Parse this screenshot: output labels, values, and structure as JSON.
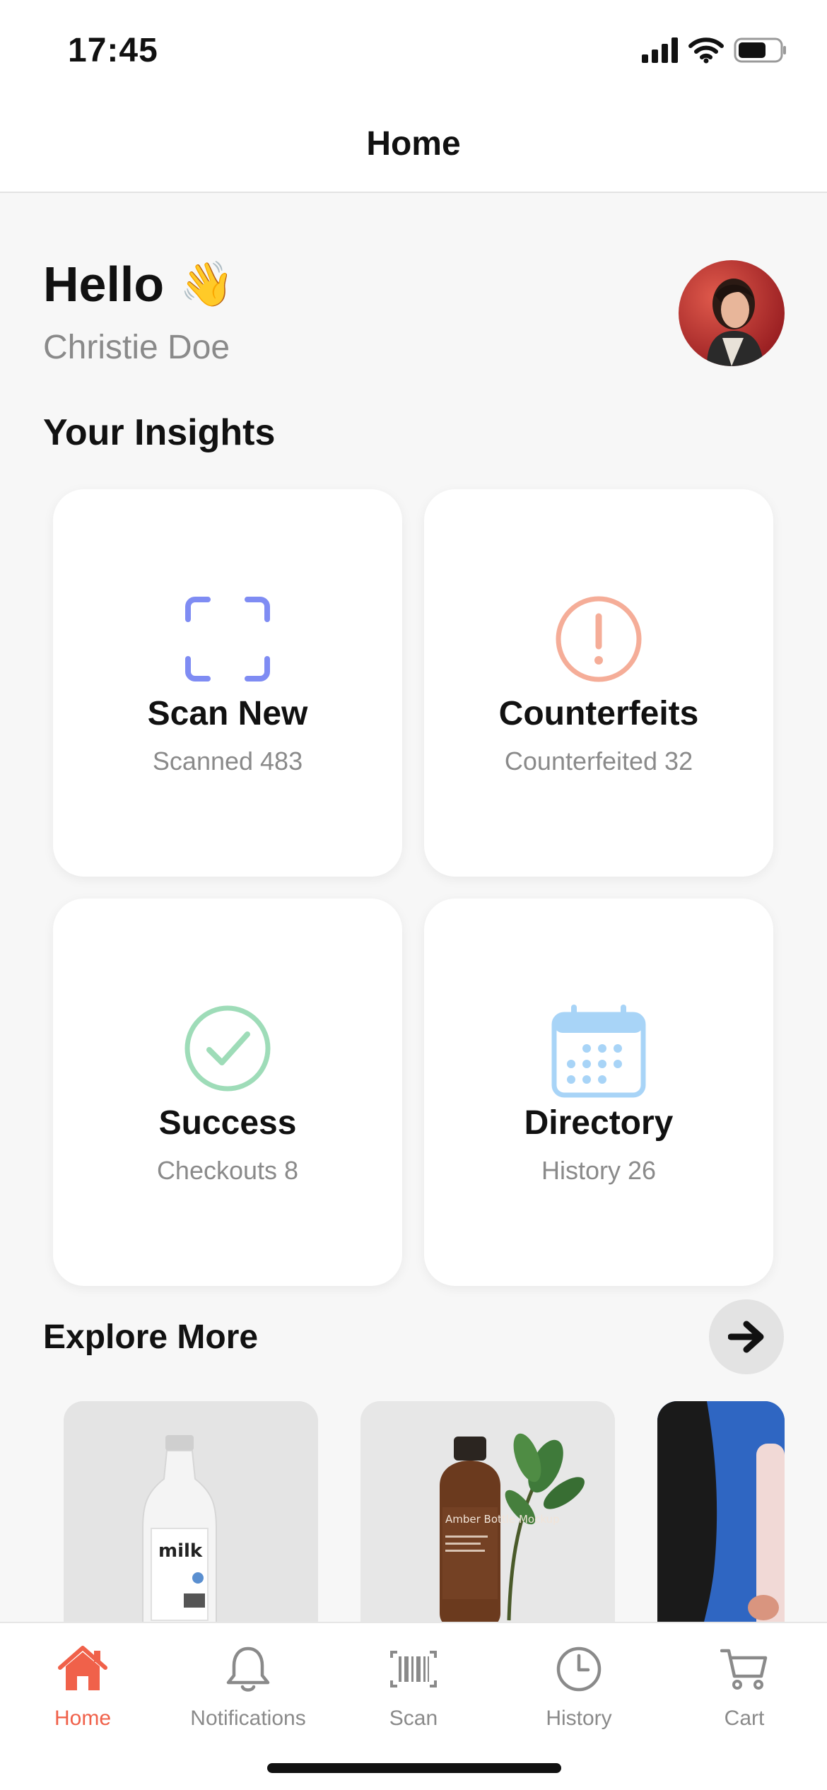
{
  "status_bar": {
    "time": "17:45"
  },
  "nav": {
    "title": "Home"
  },
  "greeting": {
    "hello": "Hello",
    "emoji": "👋",
    "name": "Christie Doe"
  },
  "insights": {
    "title": "Your Insights",
    "cards": [
      {
        "title": "Scan New",
        "subtitle": "Scanned 483",
        "icon": "scan-frame-icon",
        "color": "#7f8cf3"
      },
      {
        "title": "Counterfeits",
        "subtitle": "Counterfeited 32",
        "icon": "alert-circle-icon",
        "color": "#f5ad98"
      },
      {
        "title": "Success",
        "subtitle": "Checkouts 8",
        "icon": "check-circle-icon",
        "color": "#9edcb8"
      },
      {
        "title": "Directory",
        "subtitle": "History 26",
        "icon": "calendar-icon",
        "color": "#a8d4f7"
      }
    ]
  },
  "explore": {
    "title": "Explore More",
    "items": [
      {
        "label": "milk"
      },
      {
        "label": "Amber Bottle Mockup"
      },
      {
        "label": ""
      }
    ]
  },
  "tab_bar": {
    "active_color": "#f0614a",
    "items": [
      {
        "label": "Home",
        "icon": "home-icon"
      },
      {
        "label": "Notifications",
        "icon": "bell-icon"
      },
      {
        "label": "Scan",
        "icon": "barcode-icon"
      },
      {
        "label": "History",
        "icon": "clock-icon"
      },
      {
        "label": "Cart",
        "icon": "cart-icon"
      }
    ]
  }
}
